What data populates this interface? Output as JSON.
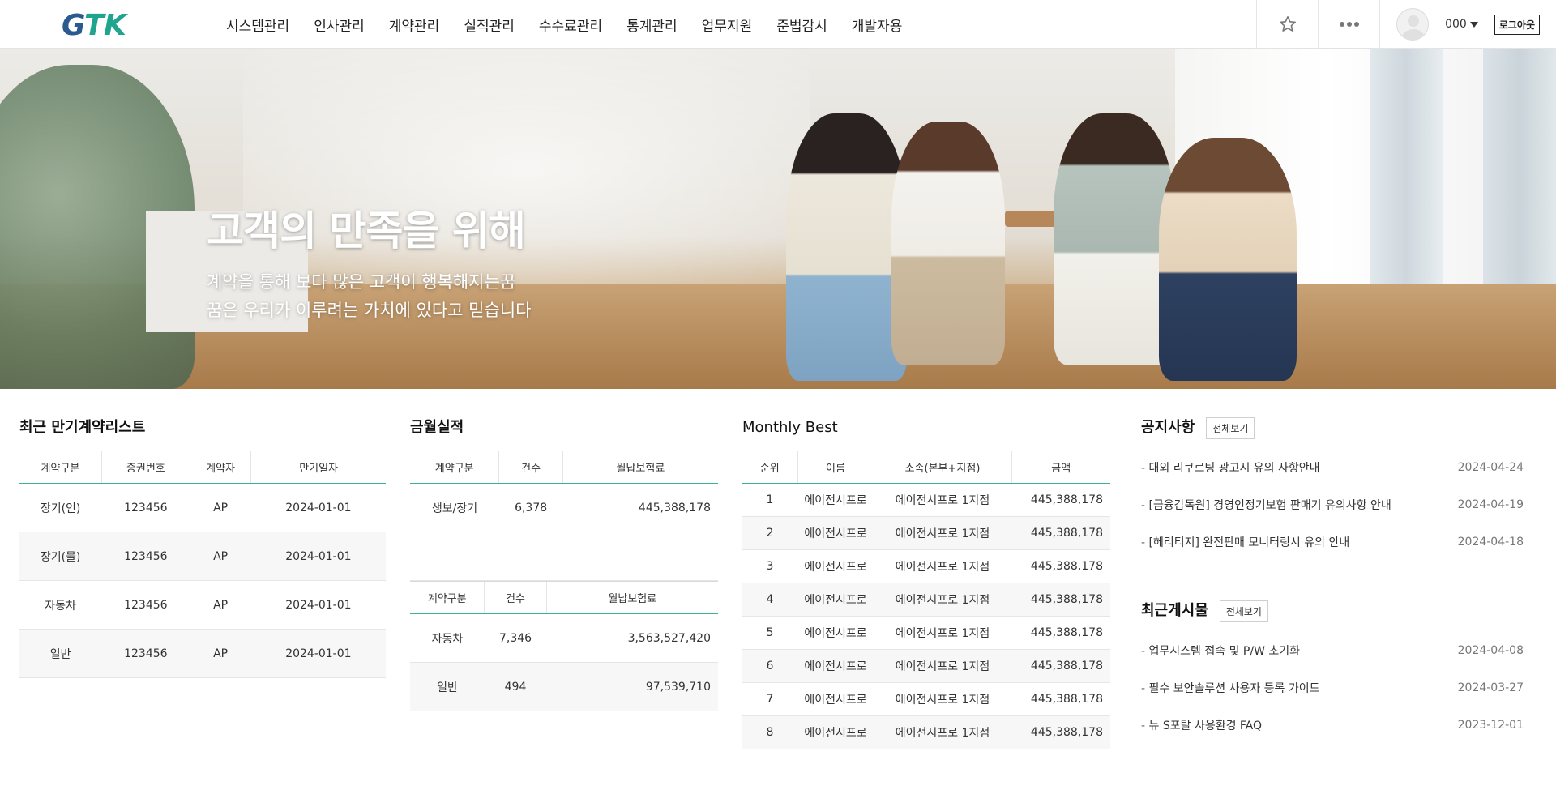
{
  "header": {
    "logo_text": "GTK",
    "nav": [
      "시스템관리",
      "인사관리",
      "계약관리",
      "실적관리",
      "수수료관리",
      "통계관리",
      "업무지원",
      "준법감시",
      "개발자용"
    ],
    "user_name": "000",
    "logout_label": "로그아웃",
    "icons": {
      "favorite": "star-icon",
      "more": "more-dots-icon",
      "avatar": "user-avatar-icon"
    }
  },
  "hero": {
    "title": "고객의 만족을 위해",
    "line1": "계약을 통해 보다 많은 고객이 행복해지는꿈",
    "line2": "꿈은 우리가 이루려는 가치에 있다고 믿습니다"
  },
  "expiring": {
    "title": "최근 만기계약리스트",
    "columns": [
      "계약구분",
      "증권번호",
      "계약자",
      "만기일자"
    ],
    "rows": [
      [
        "장기(인)",
        "123456",
        "AP",
        "2024-01-01"
      ],
      [
        "장기(물)",
        "123456",
        "AP",
        "2024-01-01"
      ],
      [
        "자동차",
        "123456",
        "AP",
        "2024-01-01"
      ],
      [
        "일반",
        "123456",
        "AP",
        "2024-01-01"
      ]
    ]
  },
  "monthly": {
    "title": "금월실적",
    "table1": {
      "columns": [
        "계약구분",
        "건수",
        "월납보험료"
      ],
      "rows": [
        [
          "생보/장기",
          "6,378",
          "445,388,178"
        ]
      ]
    },
    "table2": {
      "columns": [
        "계약구분",
        "건수",
        "월납보험료"
      ],
      "rows": [
        [
          "자동차",
          "7,346",
          "3,563,527,420"
        ],
        [
          "일반",
          "494",
          "97,539,710"
        ]
      ]
    }
  },
  "best": {
    "title": "Monthly Best",
    "columns": [
      "순위",
      "이름",
      "소속(본부+지점)",
      "금액"
    ],
    "rows": [
      [
        "1",
        "에이전시프로",
        "에이전시프로 1지점",
        "445,388,178"
      ],
      [
        "2",
        "에이전시프로",
        "에이전시프로 1지점",
        "445,388,178"
      ],
      [
        "3",
        "에이전시프로",
        "에이전시프로 1지점",
        "445,388,178"
      ],
      [
        "4",
        "에이전시프로",
        "에이전시프로 1지점",
        "445,388,178"
      ],
      [
        "5",
        "에이전시프로",
        "에이전시프로 1지점",
        "445,388,178"
      ],
      [
        "6",
        "에이전시프로",
        "에이전시프로 1지점",
        "445,388,178"
      ],
      [
        "7",
        "에이전시프로",
        "에이전시프로 1지점",
        "445,388,178"
      ],
      [
        "8",
        "에이전시프로",
        "에이전시프로 1지점",
        "445,388,178"
      ]
    ]
  },
  "notice": {
    "title": "공지사항",
    "more_label": "전체보기",
    "items": [
      {
        "title": "대외 리쿠르팅 광고시 유의 사항안내",
        "date": "2024-04-24"
      },
      {
        "title": "[금융감독원] 경영인정기보험 판매기 유의사항 안내",
        "date": "2024-04-19"
      },
      {
        "title": "[헤리티지] 완전판매 모니터링시 유의 안내",
        "date": "2024-04-18"
      }
    ]
  },
  "recent": {
    "title": "최근게시물",
    "more_label": "전체보기",
    "items": [
      {
        "title": "업무시스템 접속 및 P/W 초기화",
        "date": "2024-04-08"
      },
      {
        "title": "필수 보안솔루션 사용자 등록 가이드",
        "date": "2024-03-27"
      },
      {
        "title": "뉴 S포탈 사용환경 FAQ",
        "date": "2023-12-01"
      }
    ]
  },
  "colors": {
    "accent": "#3cb193",
    "logo_blue": "#2b5a8f",
    "logo_teal": "#1fa58f"
  }
}
